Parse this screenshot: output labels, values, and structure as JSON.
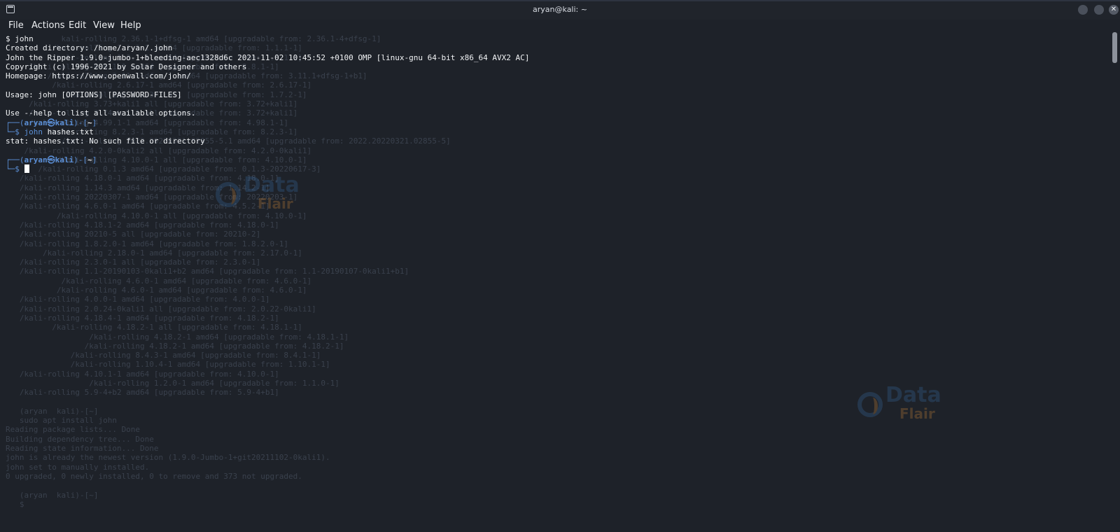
{
  "window": {
    "title": "aryan@kali: ~",
    "minimize_icon": "circle-icon",
    "maximize_icon": "circle-icon",
    "close_label": "✕"
  },
  "menu": {
    "items": [
      {
        "label": "File"
      },
      {
        "label": "Actions"
      },
      {
        "label": "Edit"
      },
      {
        "label": "View"
      },
      {
        "label": "Help"
      }
    ]
  },
  "terminal": {
    "lines": [
      "$ john",
      "Created directory: /home/aryan/.john",
      "John the Ripper 1.9.0-jumbo-1+bleeding-aec1328d6c 2021-11-02 10:45:52 +0100 OMP [linux-gnu 64-bit x86_64 AVX2 AC]",
      "Copyright (c) 1996-2021 by Solar Designer and others",
      "Homepage: https://www.openwall.com/john/",
      "",
      "Usage: john [OPTIONS] [PASSWORD-FILES]",
      "",
      "Use --help to list all available options."
    ],
    "prompt1": {
      "box_top": "┌──(",
      "user": "aryan㉿kali",
      "mid": ")-[",
      "path": "~",
      "end": "]",
      "box_bottom": "└─$ ",
      "command": "john",
      "args": " hashes.txt"
    },
    "error_line": "stat: hashes.txt: No such file or directory",
    "prompt2": {
      "box_top": "┌──(",
      "user": "aryan㉿kali",
      "mid": ")-[",
      "path": "~",
      "end": "]",
      "box_bottom": "└─$ "
    }
  },
  "watermarks": {
    "brand_top": "Data",
    "brand_bottom": "Flair"
  },
  "background_text": [
    "            kali-rolling 2.36.1-1+dfsg-1 amd64 [upgradable from: 2.36.1-4+dfsg-1]",
    "          /kali-rolling 1.1.1-1 amd64 [upgradable from: 1.1.1-1]",
    "          /kali-rolling 1.3.1-1 amd64 [upgradable from: 1.3.1-1]",
    "     /kali-rolling 8.8.1-1 amd64 [upgradable from: 8.8.1-1]",
    "         /kali-rolling 3.11.1+dfsg-1 amd64 [upgradable from: 3.11.1+dfsg-1+b1]",
    "          /kali-rolling 2.6.17-1 amd64 [upgradable from: 2.6.17-1]",
    "             /kali-rolling 1.7.3-1 all [upgradable from: 1.7.2-1]",
    "     /kali-rolling 3.73+kali1 all [upgradable from: 3.72+kali1]",
    "     /kali-rolling 3.74+kali1 all [upgradable from: 3.72+kali1]",
    "     /kali-rolling 4.99.1-1 amd64 [upgradable from: 4.98.1-1]",
    "         /kali-rolling 8.2.3-1 amd64 [upgradable from: 8.2.3-1]",
    "            /kali-rolling 2022.20220321.02855-5.1 amd64 [upgradable from: 2022.20220321.02855-5]",
    "    /kali-rolling 4.2.0-0kali2 all [upgradable from: 4.2.0-0kali1]",
    "           /kali-rolling 4.10.0-1 all [upgradable from: 4.10.0-1]",
    "       /kali-rolling 0.1.3 amd64 [upgradable from: 0.1.3-20220617-3]",
    "   /kali-rolling 4.18.0-1 amd64 [upgradable from: 4.18.0-1]",
    "   /kali-rolling 1.14.3 amd64 [upgradable from: 1.14.2-1]",
    "   /kali-rolling 20220307-1 amd64 [upgradable from: 20220203-1]",
    "   /kali-rolling 4.6.0-1 amd64 [upgradable from: 4.5.2-1]",
    "           /kali-rolling 4.10.0-1 all [upgradable from: 4.10.0-1]",
    "   /kali-rolling 4.18.1-2 amd64 [upgradable from: 4.18.0-1]",
    "   /kali-rolling 20210-5 all [upgradable from: 20210-2]",
    "   /kali-rolling 1.8.2.0-1 amd64 [upgradable from: 1.8.2.0-1]",
    "        /kali-rolling 2.18.0-1 amd64 [upgradable from: 2.17.0-1]",
    "   /kali-rolling 2.3.0-1 all [upgradable from: 2.3.0-1]",
    "   /kali-rolling 1.1-20190103-0kali1+b2 amd64 [upgradable from: 1.1-20190107-0kali1+b1]",
    "            /kali-rolling 4.6.0-1 amd64 [upgradable from: 4.6.0-1]",
    "           /kali-rolling 4.6.0-1 amd64 [upgradable from: 4.6.0-1]",
    "   /kali-rolling 4.0.0-1 amd64 [upgradable from: 4.0.0-1]",
    "   /kali-rolling 2.0.24-0kali1 all [upgradable from: 2.0.22-0kali1]",
    "   /kali-rolling 4.18.4-1 amd64 [upgradable from: 4.18.2-1]",
    "          /kali-rolling 4.18.2-1 all [upgradable from: 4.18.1-1]",
    "                  /kali-rolling 4.18.2-1 amd64 [upgradable from: 4.18.1-1]",
    "                 /kali-rolling 4.18.2-1 amd64 [upgradable from: 4.18.2-1]",
    "              /kali-rolling 8.4.3-1 amd64 [upgradable from: 8.4.1-1]",
    "              /kali-rolling 1.10.4-1 amd64 [upgradable from: 1.10.1-1]",
    "   /kali-rolling 4.10.1-1 amd64 [upgradable from: 4.10.0-1]",
    "                  /kali-rolling 1.2.0-1 amd64 [upgradable from: 1.1.0-1]",
    "   /kali-rolling 5.9-4+b2 amd64 [upgradable from: 5.9-4+b1]",
    "",
    "   (aryan  kali)-[~]",
    "   sudo apt install john",
    "Reading package lists... Done",
    "Building dependency tree... Done",
    "Reading state information... Done",
    "john is already the newest version (1.9.0-Jumbo-1+git20211102-0kali1).",
    "john set to manually installed.",
    "0 upgraded, 0 newly installed, 0 to remove and 373 not upgraded.",
    "",
    "   (aryan  kali)-[~]",
    "   $ "
  ]
}
